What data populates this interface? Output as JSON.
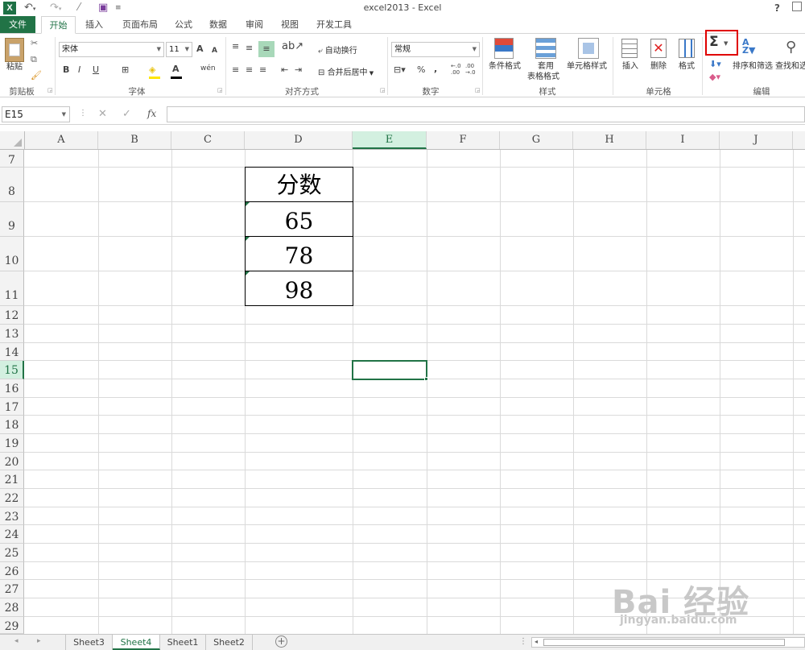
{
  "window": {
    "title": "excel2013 - Excel",
    "help": "?"
  },
  "tabs": [
    "文件",
    "开始",
    "插入",
    "页面布局",
    "公式",
    "数据",
    "审阅",
    "视图",
    "开发工具"
  ],
  "ribbon": {
    "clipboard": {
      "label": "剪贴板",
      "paste": "粘贴"
    },
    "font": {
      "label": "字体",
      "name": "宋体",
      "size": "11",
      "bold": "B",
      "italic": "I",
      "underline": "U",
      "grow": "A",
      "shrink": "A",
      "font_color": "A",
      "phonetic": "wén"
    },
    "alignment": {
      "label": "对齐方式",
      "wrap": "自动换行",
      "merge": "合并后居中"
    },
    "number": {
      "label": "数字",
      "format": "常规",
      "percent": "%",
      "comma": ",",
      "inc_decimal": "←.0\n.00",
      "dec_decimal": ".00\n→.0"
    },
    "styles": {
      "label": "样式",
      "conditional": "条件格式",
      "table": "套用",
      "table2": "表格格式",
      "cell_styles": "单元格样式"
    },
    "cells": {
      "label": "单元格",
      "insert": "插入",
      "delete": "删除",
      "format": "格式"
    },
    "editing": {
      "label": "编辑",
      "autosum": "Σ",
      "sort": "排序和筛选",
      "find": "查找和选"
    }
  },
  "formula_bar": {
    "name_box": "E15",
    "fx": "fx",
    "content": ""
  },
  "columns": [
    "A",
    "B",
    "C",
    "D",
    "E",
    "F",
    "G",
    "H",
    "I",
    "J"
  ],
  "selected_column": "E",
  "rows": [
    "7",
    "8",
    "9",
    "10",
    "11",
    "12",
    "13",
    "14",
    "15",
    "16",
    "17",
    "18",
    "19",
    "20",
    "21",
    "22",
    "23",
    "24",
    "25",
    "26",
    "27",
    "28",
    "29"
  ],
  "selected_row": "15",
  "cells": {
    "D8": "分数",
    "D9": "65",
    "D10": "78",
    "D11": "98"
  },
  "sheets": [
    "Sheet3",
    "Sheet4",
    "Sheet1",
    "Sheet2"
  ],
  "active_sheet": "Sheet4",
  "watermark": {
    "text": "Bai 经验",
    "url": "jingyan.baidu.com"
  }
}
